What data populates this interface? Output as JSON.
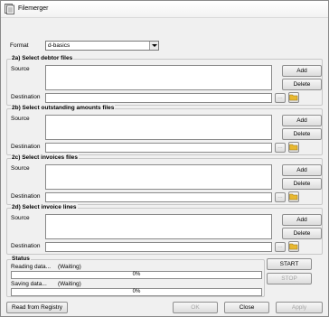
{
  "window": {
    "title": "Filemerger"
  },
  "format": {
    "label": "Format",
    "value": "d-basics"
  },
  "groups": [
    {
      "title": "2a) Select debtor files",
      "source_label": "Source",
      "dest_label": "Destination",
      "add_label": "Add",
      "delete_label": "Delete",
      "browse_label": "..."
    },
    {
      "title": "2b) Select outstanding amounts files",
      "source_label": "Source",
      "dest_label": "Destination",
      "add_label": "Add",
      "delete_label": "Delete",
      "browse_label": "..."
    },
    {
      "title": "2c) Select invoices files",
      "source_label": "Source",
      "dest_label": "Destination",
      "add_label": "Add",
      "delete_label": "Delete",
      "browse_label": "..."
    },
    {
      "title": "2d) Select invoice lines",
      "source_label": "Source",
      "dest_label": "Destination",
      "add_label": "Add",
      "delete_label": "Delete",
      "browse_label": "..."
    }
  ],
  "status": {
    "title": "Status",
    "reading_label": "Reading data...",
    "reading_state": "(Waiting)",
    "reading_progress": "0%",
    "saving_label": "Saving data...",
    "saving_state": "(Waiting)",
    "saving_progress": "0%",
    "start_label": "START",
    "stop_label": "STOP"
  },
  "footer": {
    "registry_label": "Read from Registry",
    "ok_label": "OK",
    "close_label": "Close",
    "apply_label": "Apply"
  },
  "colors": {
    "folder": "#e8b830",
    "folder_edge": "#9c7a14"
  }
}
